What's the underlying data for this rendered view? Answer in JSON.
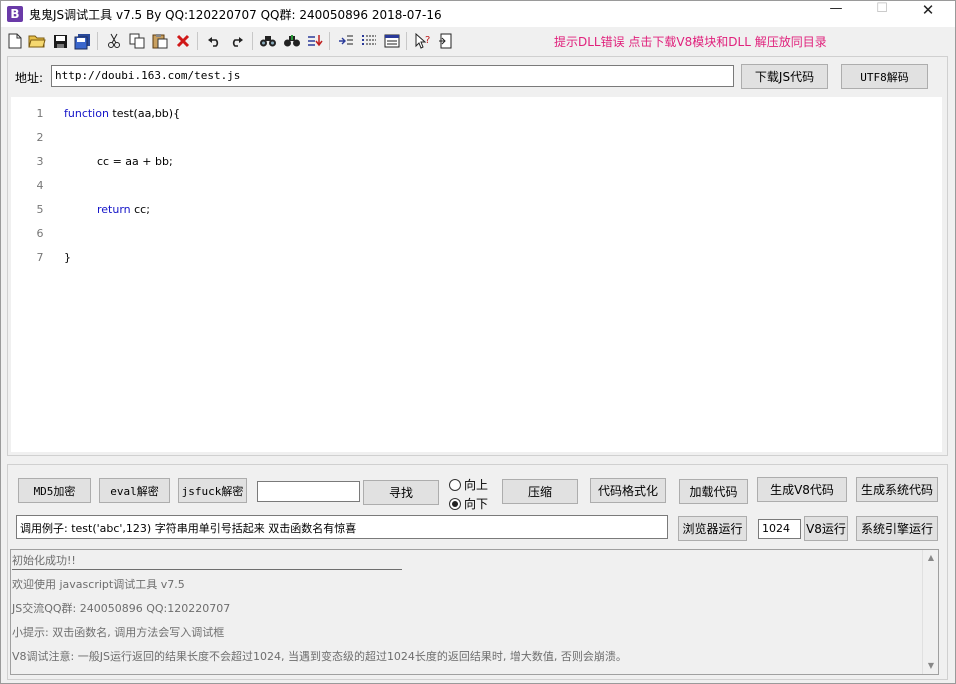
{
  "window": {
    "app_icon": "B",
    "title": "鬼鬼JS调试工具 v7.5 By QQ:120220707  QQ群: 240050896  2018-07-16",
    "min_glyph": "—",
    "max_glyph": "☐",
    "close_glyph": "✕"
  },
  "toolbar": {
    "icons": [
      "new-file-icon",
      "open-folder-icon",
      "save-icon",
      "save-all-icon",
      "cut-icon",
      "copy-icon",
      "paste-icon",
      "delete-icon",
      "undo-icon",
      "redo-icon",
      "find-icon",
      "find-replace-icon",
      "goto-line-icon",
      "indent-icon",
      "list-icon",
      "window-icon",
      "help-cursor-icon",
      "panel-icon"
    ],
    "hint": "提示DLL错误 点击下载V8模块和DLL 解压放同目录",
    "hint_color": "#e0217c"
  },
  "address": {
    "label": "地址:",
    "value": "http://doubi.163.com/test.js",
    "download_label": "下载JS代码",
    "utf8_label": "UTF8解码"
  },
  "editor": {
    "line_numbers": [
      "1",
      "2",
      "3",
      "4",
      "5",
      "6",
      "7"
    ],
    "lines": [
      {
        "keyword": "function",
        "text": " test(aa,bb){"
      },
      {
        "keyword": "",
        "text": ""
      },
      {
        "keyword": "",
        "text": "cc = aa + bb;"
      },
      {
        "keyword": "",
        "text": ""
      },
      {
        "keyword": "return",
        "text": " cc;"
      },
      {
        "keyword": "",
        "text": ""
      },
      {
        "keyword": "",
        "text": "}"
      }
    ],
    "keyword_color": "#1414c8"
  },
  "actions": {
    "md5": "MD5加密",
    "eval": "eval解密",
    "jsfuck": "jsfuck解密",
    "search_value": "",
    "find": "寻找",
    "radio_up": "向上",
    "radio_down": "向下",
    "selected_direction": "向下",
    "compress": "压缩",
    "format": "代码格式化",
    "load": "加载代码",
    "gen_v8": "生成V8代码",
    "gen_sys": "生成系统代码",
    "example": "调用例子: test('abc',123) 字符串用单引号括起来 双击函数名有惊喜",
    "browser_run": "浏览器运行",
    "size_value": "1024",
    "v8_run": "V8运行",
    "sys_run": "系统引擎运行"
  },
  "log": {
    "lines": [
      "初始化成功!!",
      "欢迎使用 javascript调试工具 v7.5",
      "JS交流QQ群: 240050896  QQ:120220707",
      "小提示: 双击函数名, 调用方法会写入调试框",
      "V8调试注意: 一般JS运行返回的结果长度不会超过1024, 当遇到变态级的超过1024长度的返回结果时, 增大数值, 否则会崩溃。"
    ],
    "text_color": "#6e6e6e"
  }
}
